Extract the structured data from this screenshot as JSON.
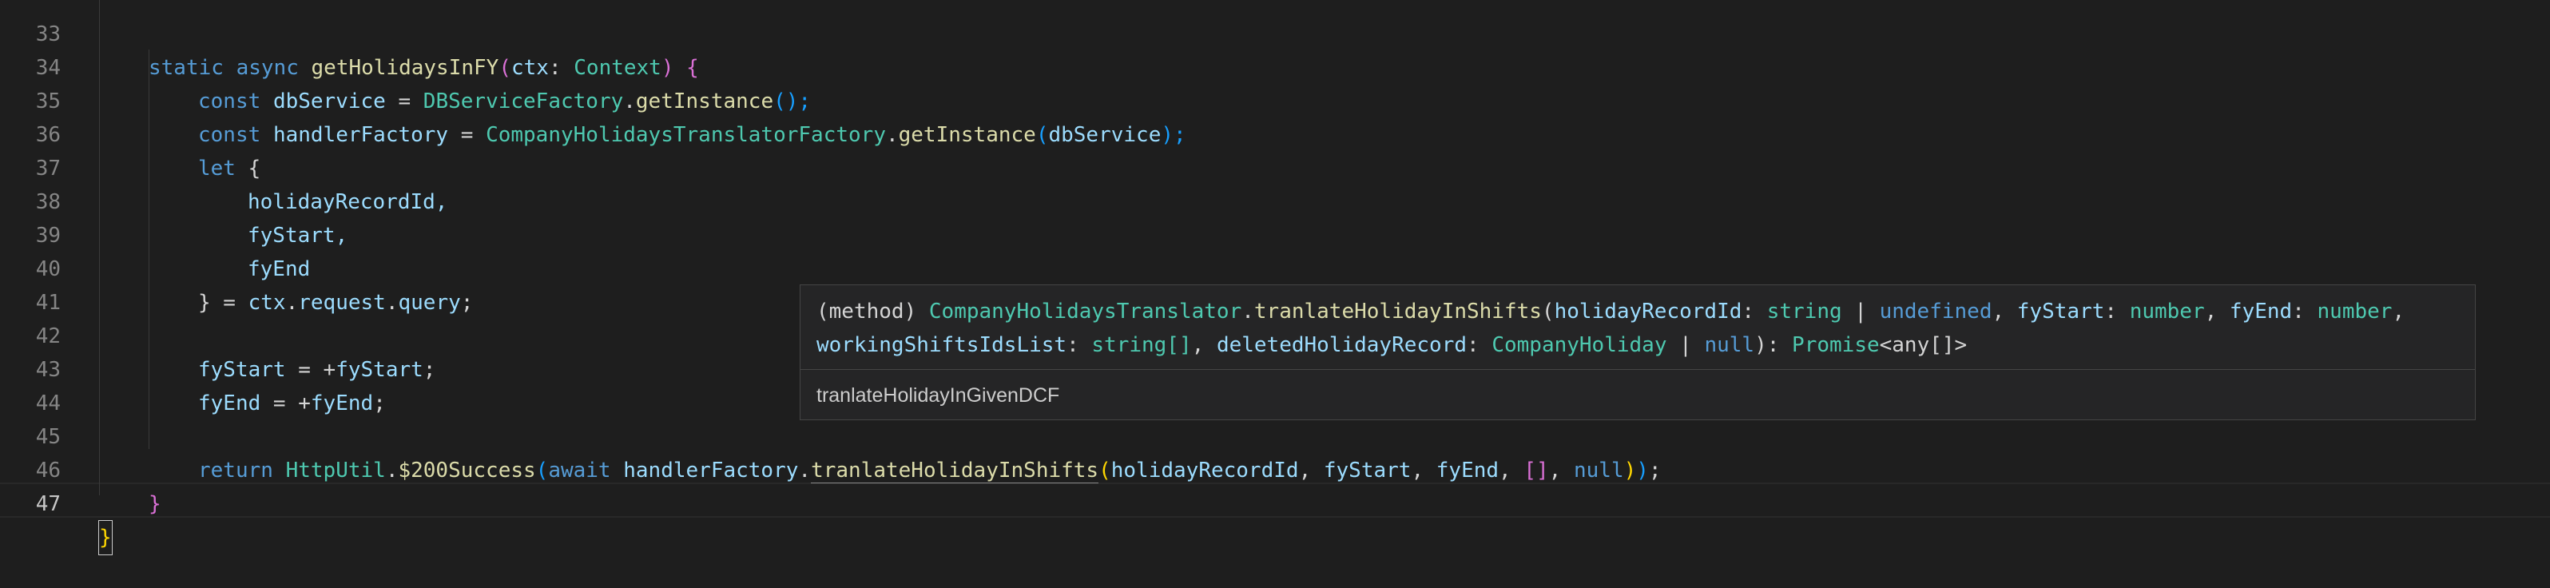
{
  "editor": {
    "line_numbers": [
      "33",
      "34",
      "35",
      "36",
      "37",
      "38",
      "39",
      "40",
      "41",
      "42",
      "43",
      "44",
      "45",
      "46",
      "47"
    ],
    "active_line": "47"
  },
  "code": {
    "l33": {
      "static": "static",
      "async": "async",
      "name": "getHolidaysInFY",
      "open": "(",
      "param": "ctx",
      "colon": ": ",
      "type": "Context",
      "close": ")",
      "brace": " {"
    },
    "l34": {
      "const": "const",
      "var": "dbService",
      "eq": " = ",
      "cls": "DBServiceFactory",
      "dot": ".",
      "fn": "getInstance",
      "args": "();"
    },
    "l35": {
      "const": "const",
      "var": "handlerFactory",
      "eq": " = ",
      "cls": "CompanyHolidaysTranslatorFactory",
      "dot": ".",
      "fn": "getInstance",
      "open": "(",
      "arg": "dbService",
      "close": ");"
    },
    "l36": {
      "let": "let",
      "brace": " {"
    },
    "l37": {
      "text": "holidayRecordId,"
    },
    "l38": {
      "text": "fyStart,"
    },
    "l39": {
      "text": "fyEnd"
    },
    "l40": {
      "close": "} = ",
      "obj": "ctx",
      "d1": ".",
      "p1": "request",
      "d2": ".",
      "p2": "query",
      "end": ";"
    },
    "l42": {
      "var": "fyStart",
      "eq": " = +",
      "rhs": "fyStart",
      "end": ";"
    },
    "l43": {
      "var": "fyEnd",
      "eq": " = +",
      "rhs": "fyEnd",
      "end": ";"
    },
    "l45": {
      "ret": "return",
      "cls": "HttpUtil",
      "dot": ".",
      "fn": "$200Success",
      "open": "(",
      "await": "await",
      "obj": "handlerFactory",
      "dot2": ".",
      "method": "tranlateHolidayInShifts",
      "open2": "(",
      "a1": "holidayRecordId",
      "c1": ", ",
      "a2": "fyStart",
      "c2": ", ",
      "a3": "fyEnd",
      "c3": ", ",
      "arr": "[]",
      "c4": ", ",
      "nul": "null",
      "close2": ")",
      "close": ")",
      "end": ";"
    },
    "l46": {
      "brace": "}"
    },
    "l47": {
      "brace": "}"
    }
  },
  "hover": {
    "sig1_kind": "(method) ",
    "sig1_cls": "CompanyHolidaysTranslator",
    "sig1_dot": ".",
    "sig1_fn": "tranlateHolidayInShifts",
    "sig1_open": "(",
    "p1": "holidayRecordId",
    "p1_colon": ": ",
    "p1_type": "string",
    "p1_bar": " | ",
    "p1_undef": "undefined",
    "p1_comma": ", ",
    "p2": "fyStart",
    "p2_colon": ": ",
    "p2_type": "number",
    "p2_comma": ", ",
    "p3": "fyEnd",
    "p3_colon": ": ",
    "p3_type": "number",
    "p3_comma": ",",
    "p4": "workingShiftsIdsList",
    "p4_colon": ": ",
    "p4_type": "string[]",
    "p4_comma": ", ",
    "p5": "deletedHolidayRecord",
    "p5_colon": ": ",
    "p5_type": "CompanyHoliday",
    "p5_bar": " | ",
    "p5_null": "null",
    "sig2_close": "): ",
    "ret_type": "Promise",
    "ret_args": "<any[]>",
    "doc": "tranlateHolidayInGivenDCF"
  }
}
